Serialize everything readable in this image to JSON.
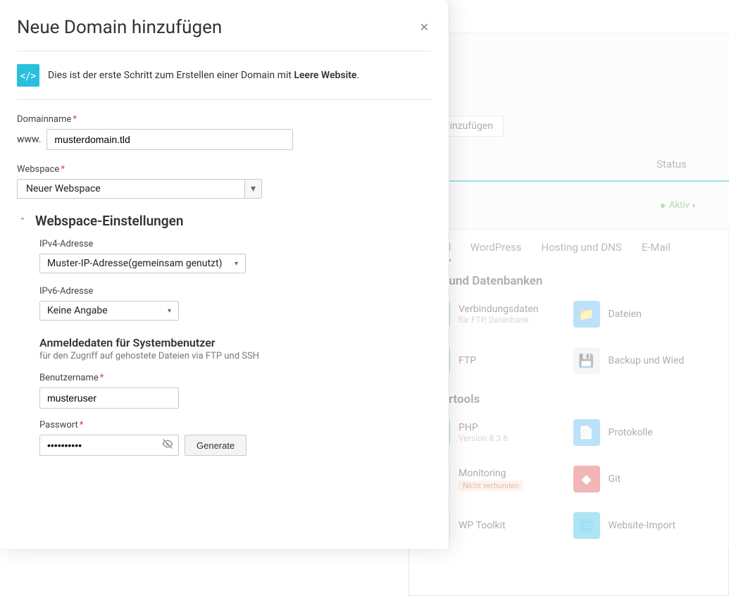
{
  "modal": {
    "title": "Neue Domain hinzufügen",
    "hint_pre": "Dies ist der erste Schritt zum Erstellen einer Domain mit ",
    "hint_bold": "Leere Website",
    "hint_post": ".",
    "domain_label": "Domainname",
    "domain_prefix": "www.",
    "domain_value": "musterdomain.tld",
    "webspace_label": "Webspace",
    "webspace_value": "Neuer Webspace",
    "settings_title": "Webspace-Einstellungen",
    "ipv4_label": "IPv4-Adresse",
    "ipv4_value": "Muster-IP-Adresse(gemeinsam genutzt)",
    "ipv6_label": "IPv6-Adresse",
    "ipv6_value": "Keine Angabe",
    "creds_title": "Anmeldedaten für Systembenutzer",
    "creds_sub": "für den Zugriff auf gehostete Dateien via FTP und SSH",
    "user_label": "Benutzername",
    "user_value": "musteruser",
    "pw_label": "Passwort",
    "pw_value": "••••••••••",
    "generate_label": "Generate"
  },
  "bg": {
    "alias_btn": "n-Alias hinzufügen",
    "status_head": "Status",
    "aktiv": "Aktiv",
    "tabs": {
      "dashboard": "board",
      "wp": "WordPress",
      "hosting": "Hosting und DNS",
      "email": "E-Mail"
    },
    "sect_files": "eien und Datenbanken",
    "sect_dev": "icklertools",
    "items": {
      "conn": "Verbindungsdaten",
      "conn_sub": "für FTP, Datenbank",
      "files": "Dateien",
      "ftp": "FTP",
      "backup": "Backup und Wied",
      "php": "PHP",
      "php_sub": "Version 8.3.6",
      "logs": "Protokolle",
      "monitoring": "Monitoring",
      "monitoring_badge": "Nicht verbunden",
      "git": "Git",
      "wpt": "WP Toolkit",
      "import": "Website-Import"
    }
  }
}
